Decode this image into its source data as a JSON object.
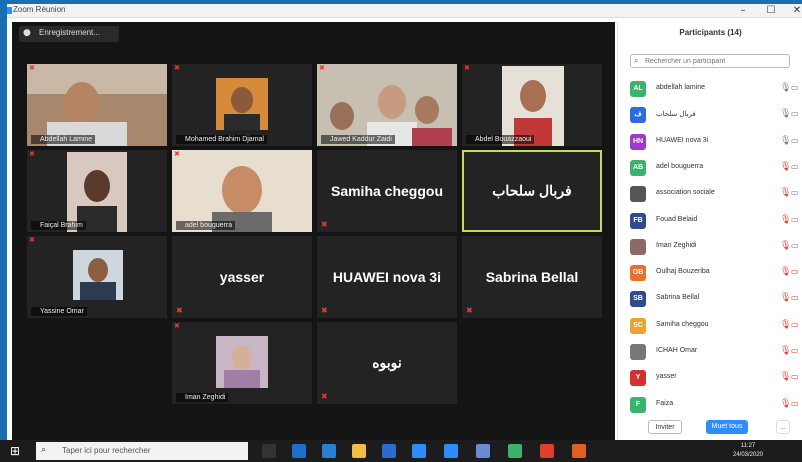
{
  "window": {
    "title": "Zoom Réunion"
  },
  "video_header": {
    "view_label": "Enregistrement..."
  },
  "tiles": [
    {
      "name": "Abdellah Lamine"
    },
    {
      "name": "Mohamed Brahim Djamal"
    },
    {
      "name": "Jawed Kaddur Zaidi"
    },
    {
      "name": "Abdel Bouazzaoui"
    },
    {
      "name": "Faiçal Brahim"
    },
    {
      "name": "adel bouguerra"
    },
    {
      "name": "Samiha cheggou"
    },
    {
      "name": "فربال سلحاب"
    },
    {
      "name": "Yassine Omar"
    },
    {
      "name": "yasser"
    },
    {
      "name": "HUAWEI nova 3i"
    },
    {
      "name": "Sabrina Bellal"
    },
    {
      "name": "Iman Zeghidi"
    },
    {
      "name": "نوبوه"
    }
  ],
  "panel": {
    "title": "Participants (14)",
    "search_placeholder": "Rechercher un participant",
    "participants": [
      {
        "name": "abdellah lamine",
        "initials": "AL",
        "color": "#3bb36a"
      },
      {
        "name": "فربال سلحاب",
        "initials": "ف",
        "color": "#2d6cdf"
      },
      {
        "name": "HUAWEI nova 3i",
        "initials": "HN",
        "color": "#9c3bc9"
      },
      {
        "name": "adel bouguerra",
        "initials": "AB",
        "color": "#3bb36a"
      },
      {
        "name": "association sociale",
        "initials": "",
        "color": "#555555"
      },
      {
        "name": "Fouad Belaid",
        "initials": "FB",
        "color": "#2d4d8a"
      },
      {
        "name": "Iman Zeghidi",
        "initials": "",
        "color": "#8a6b66"
      },
      {
        "name": "Oulhaj Bouzeriba",
        "initials": "OB",
        "color": "#e8702a"
      },
      {
        "name": "Sabrina Bellal",
        "initials": "SB",
        "color": "#2d4d8a"
      },
      {
        "name": "Samiha cheggou",
        "initials": "SC",
        "color": "#f0a030"
      },
      {
        "name": "ICHAH Omar",
        "initials": "",
        "color": "#777777"
      },
      {
        "name": "yasser",
        "initials": "Y",
        "color": "#d83030"
      },
      {
        "name": "Faiza",
        "initials": "F",
        "color": "#3bb36a"
      }
    ],
    "invite_label": "Inviter",
    "mute_all_label": "Muet tous",
    "more_label": "..."
  },
  "taskbar": {
    "search_placeholder": "Taper ici pour rechercher",
    "time": "11:27",
    "date": "24/03/2020"
  }
}
